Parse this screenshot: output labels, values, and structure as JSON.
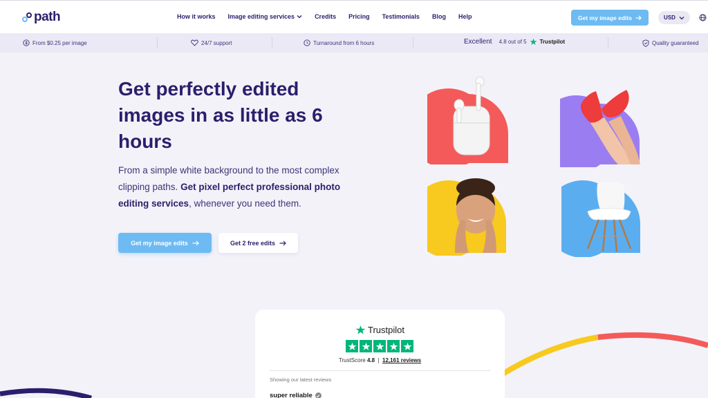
{
  "brand": {
    "name": "path",
    "accent": "#6ebaf2",
    "primary_text": "#2a1f6b",
    "trustpilot_green": "#00b67a"
  },
  "nav": {
    "items": [
      {
        "label": "How it works"
      },
      {
        "label": "Image editing services",
        "has_dropdown": true
      },
      {
        "label": "Credits"
      },
      {
        "label": "Pricing"
      },
      {
        "label": "Testimonials"
      },
      {
        "label": "Blog"
      },
      {
        "label": "Help"
      }
    ],
    "cta_label": "Get my image edits",
    "currency": "USD"
  },
  "infobar": {
    "price": "From $0.25 per image",
    "support": "24/7 support",
    "turnaround": "Turnaround from 6 hours",
    "rating_word": "Excellent",
    "rating_text": "4.8 out of 5",
    "trustpilot": "Trustpilot",
    "quality": "Quality guaranteed"
  },
  "hero": {
    "title": "Get perfectly edited images in as little as 6 hours",
    "subtitle_pre": "From a simple white background to the most complex clipping paths. ",
    "subtitle_bold": "Get pixel perfect professional photo editing services",
    "subtitle_post": ", whenever you need them.",
    "primary_button": "Get my image edits",
    "secondary_button": "Get 2 free edits"
  },
  "visuals": [
    {
      "subject": "earbuds-case",
      "bg_color": "#f45a5a"
    },
    {
      "subject": "legs-red-sneakers",
      "bg_color": "#9b7df2"
    },
    {
      "subject": "smiling-woman",
      "bg_color": "#f8c91e"
    },
    {
      "subject": "white-chair",
      "bg_color": "#5aaef0"
    }
  ],
  "trustpilot_widget": {
    "logo_text": "Trustpilot",
    "score_label": "TrustScore",
    "score": "4.8",
    "separator": "|",
    "reviews": "12,161",
    "reviews_word": "reviews",
    "latest_label": "Showing our latest reviews",
    "review_title": "super reliable"
  }
}
